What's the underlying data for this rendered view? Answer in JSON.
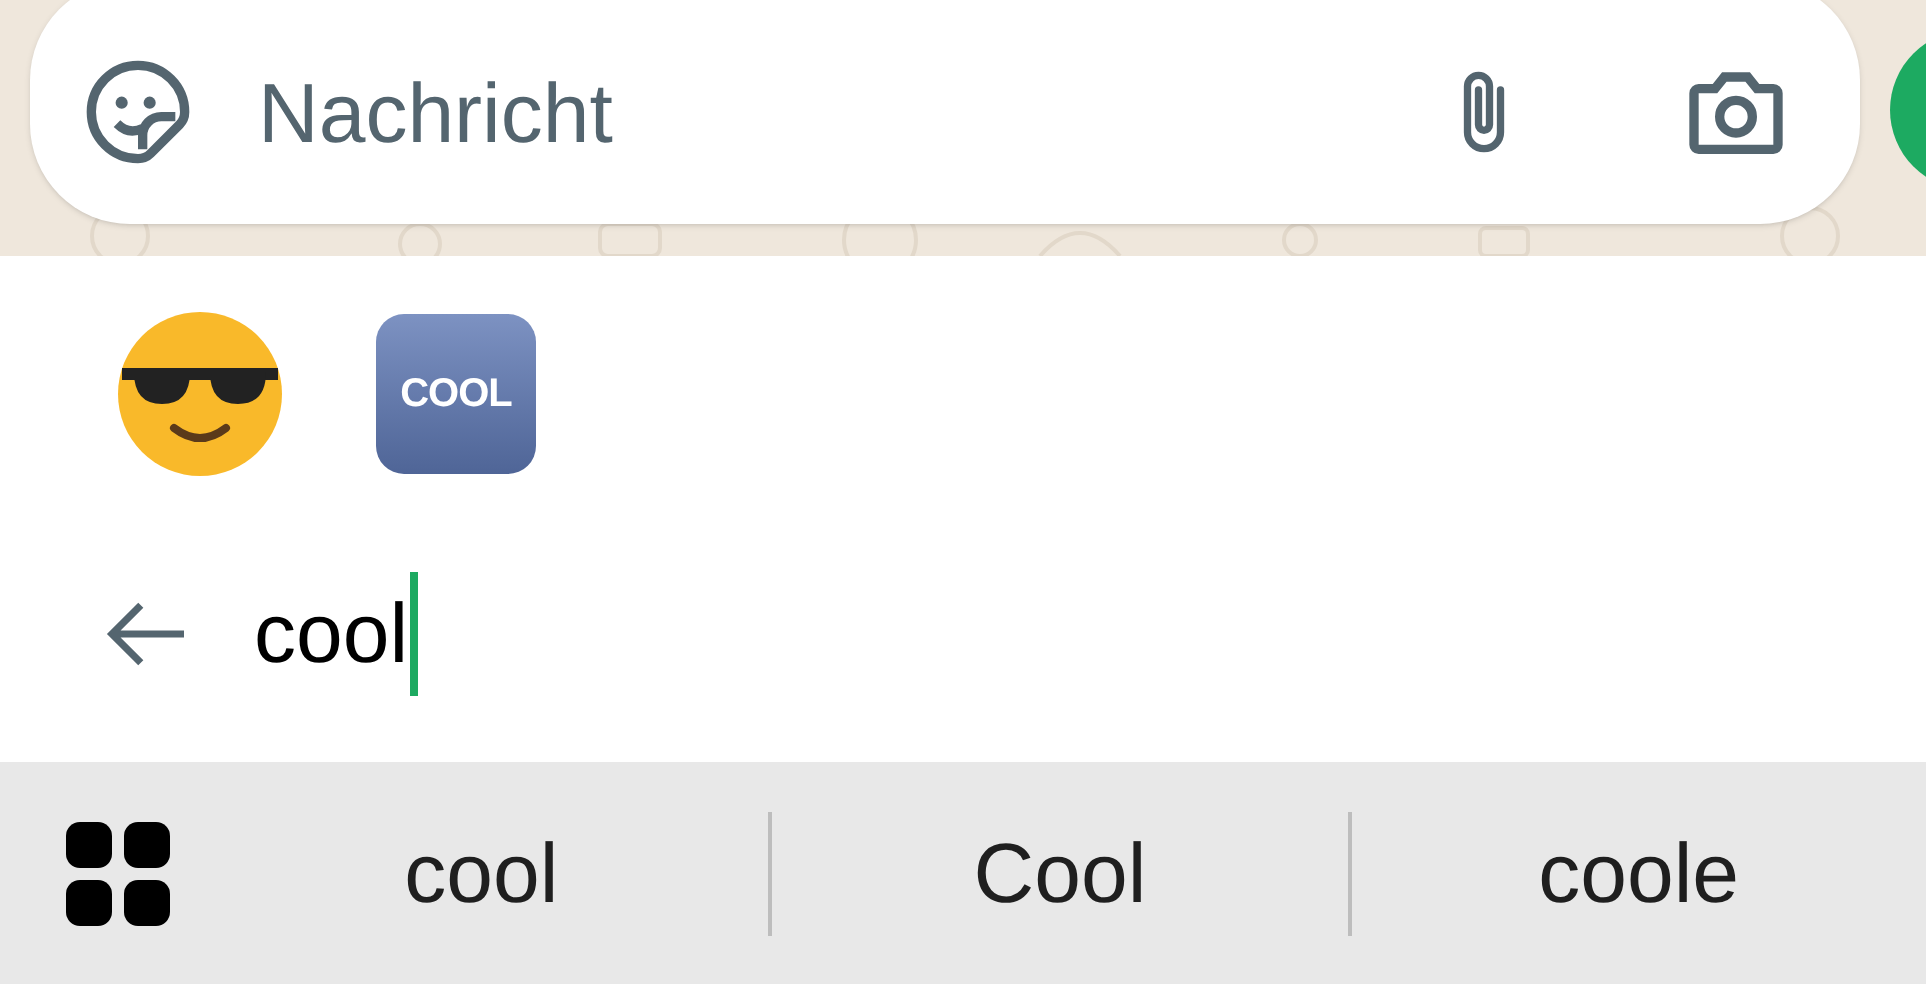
{
  "composer": {
    "placeholder": "Nachricht"
  },
  "emoji_results": [
    {
      "kind": "smiley"
    },
    {
      "kind": "word",
      "label": "COOL"
    }
  ],
  "search": {
    "value": "cool"
  },
  "suggestions": [
    {
      "text": "cool"
    },
    {
      "text": "Cool"
    },
    {
      "text": "coole"
    }
  ]
}
